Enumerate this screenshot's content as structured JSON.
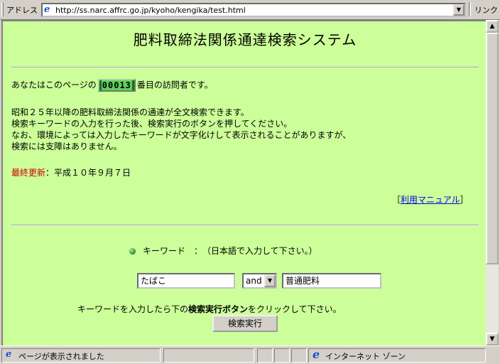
{
  "address_bar": {
    "label": "アドレス",
    "url": "http://ss.narc.affrc.go.jp/kyoho/kengika/test.html",
    "links_label": "リンク"
  },
  "page": {
    "title": "肥料取締法関係通達検索システム",
    "visitor_prefix": "あなたはこのページの",
    "visitor_count": "00013",
    "visitor_suffix": "番目の訪問者です。",
    "intro_line1": "昭和２５年以降の肥料取締法関係の通達が全文検索できます。",
    "intro_line2": "検索キーワードの入力を行った後、検索実行のボタンを押してください。",
    "intro_line3": "なお、環境によっては入力したキーワードが文字化けして表示されることがありますが、",
    "intro_line4": "検索には支障はありません。",
    "updated_label": "最終更新",
    "updated_value": "：平成１０年９月７日",
    "manual_open": "［",
    "manual_link": "利用マニュアル",
    "manual_close": "］",
    "keyword_prompt": "キーワード　：　（日本語で入力して下さい。）",
    "keyword1_value": "たばこ",
    "operator_value": "and",
    "keyword2_value": "普通肥料",
    "instruction_pre": "キーワードを入力したら下の",
    "instruction_bold": "検索実行ボタン",
    "instruction_post": "をクリックして下さい。",
    "search_button": "検索実行"
  },
  "status_bar": {
    "text": "ページが表示されました",
    "zone": "インターネット ゾーン"
  },
  "colors": {
    "page_background": "#ccff99",
    "updated_label": "#cc0000",
    "link": "#0000ee"
  },
  "icons": {
    "address_icon": "ie-page-icon",
    "status_icon": "ie-page-icon",
    "zone_icon": "internet-explorer-icon",
    "bullet": "green-ball-icon"
  }
}
